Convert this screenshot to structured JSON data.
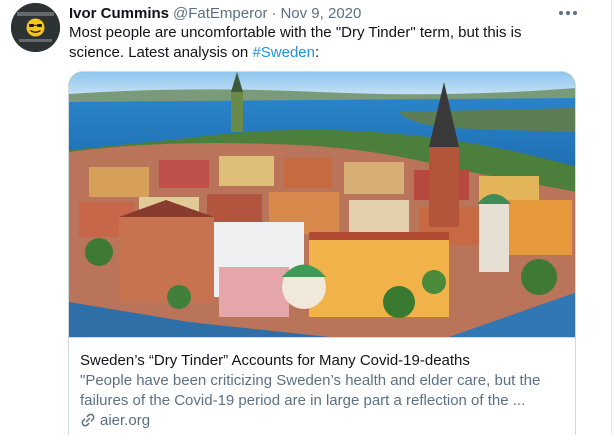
{
  "tweet": {
    "author_name": "Ivor Cummins",
    "author_handle": "@FatEmperor",
    "separator": "·",
    "date": "Nov 9, 2020",
    "text_before": "Most people are uncomfortable with the \"Dry Tinder\" term, but this is science. Latest analysis on ",
    "hashtag": "#Sweden",
    "text_after": ":"
  },
  "card": {
    "title": "Sweden’s “Dry Tinder” Accounts for Many Covid-19-deaths",
    "description": "\"People have been criticizing Sweden’s health and elder care, but the failures of the Covid-19 period are in large part a reflection of the ...",
    "domain": "aier.org",
    "image_subject": "aerial view of Stockholm old town"
  },
  "icons": {
    "more": "more-icon",
    "link": "link-icon",
    "avatar": "avatar-emoji-icon"
  },
  "colors": {
    "text": "#0f1419",
    "secondary": "#5b7083",
    "link": "#1b95e0",
    "border": "#cfd9de"
  }
}
